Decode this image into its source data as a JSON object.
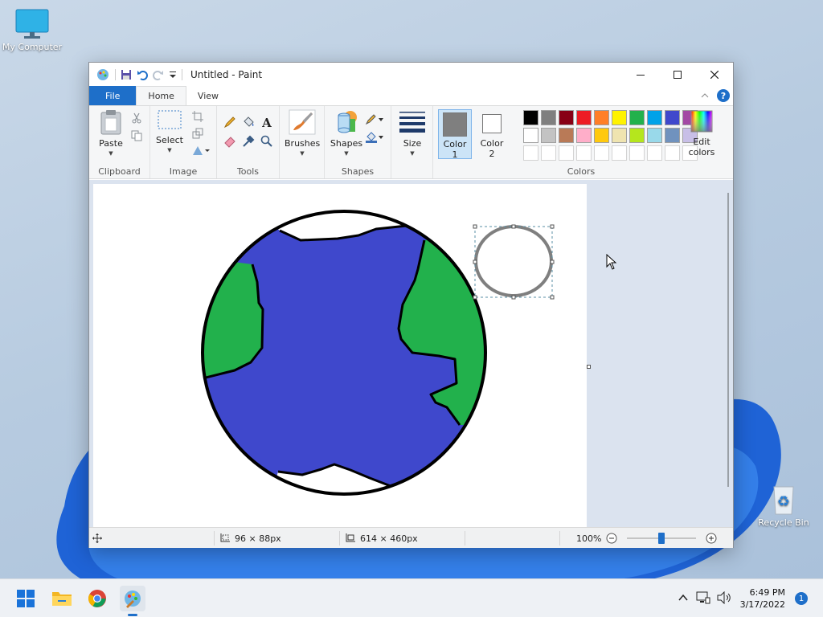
{
  "desktop": {
    "icons": [
      {
        "label": "My Computer"
      },
      {
        "label": "Recycle Bin"
      }
    ]
  },
  "window": {
    "title": "Untitled - Paint",
    "tabs": [
      {
        "label": "File"
      },
      {
        "label": "Home"
      },
      {
        "label": "View"
      }
    ]
  },
  "ribbon": {
    "groups": {
      "clipboard": "Clipboard",
      "image": "Image",
      "tools": "Tools",
      "shapes": "Shapes",
      "colors": "Colors"
    },
    "buttons": {
      "paste": "Paste",
      "select": "Select",
      "brushes": "Brushes",
      "shapes": "Shapes",
      "size": "Size",
      "color1_line1": "Color",
      "color1_line2": "1",
      "color2_line1": "Color",
      "color2_line2": "2",
      "edit_colors_line1": "Edit",
      "edit_colors_line2": "colors"
    },
    "color1": "#7f7f7f",
    "color2": "#ffffff",
    "palette_row1": [
      "#000000",
      "#7f7f7f",
      "#880015",
      "#ed1c24",
      "#ff7f27",
      "#fff200",
      "#22b14c",
      "#00a2e8",
      "#3f48cc",
      "#a349a4"
    ],
    "palette_row2": [
      "#ffffff",
      "#c3c3c3",
      "#b97a57",
      "#ffaec9",
      "#ffc90e",
      "#efe4b0",
      "#b5e61d",
      "#99d9ea",
      "#7092be",
      "#c8bfe7"
    ]
  },
  "drawing": {
    "ocean_color": "#3f48cc",
    "land_color": "#22b14c",
    "outline_color": "#000000",
    "ellipse_color": "#7f7f7f"
  },
  "statusbar": {
    "selection_size": "96 × 88px",
    "canvas_size": "614 × 460px",
    "zoom": "100%",
    "zoom_level": 0.5
  },
  "taskbar": {
    "time": "6:49 PM",
    "date": "3/17/2022",
    "notification_count": "1"
  }
}
